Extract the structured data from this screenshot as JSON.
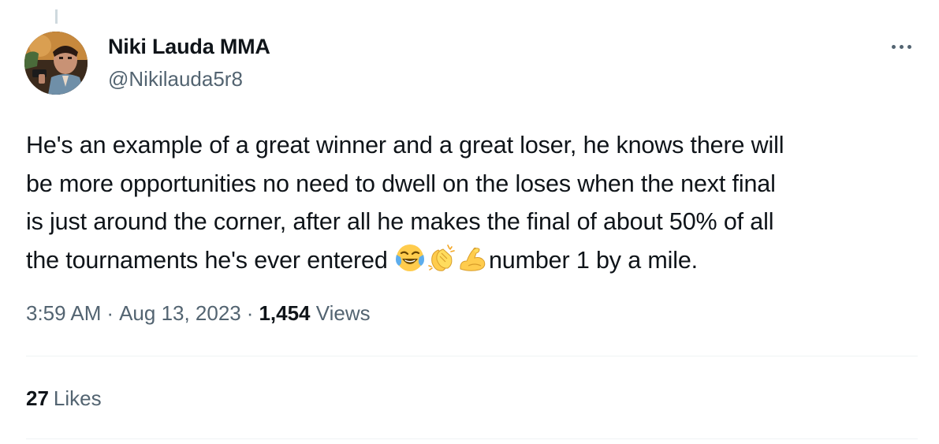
{
  "author": {
    "display_name": "Niki Lauda MMA",
    "handle": "@Nikilauda5r8",
    "avatar_icon": "profile-photo"
  },
  "tweet": {
    "line1": "He's an example of a great winner and a great loser, he knows there will",
    "line2": "be more opportunities no need to dwell on the loses when the next final",
    "line3": "is just around the corner, after all he makes the final of about 50% of all",
    "line4_before": "the tournaments he's ever entered ",
    "line4_after": "number 1 by a mile.",
    "emojis": [
      "face-with-tears-of-joy-emoji",
      "clapping-hands-emoji",
      "flexed-biceps-emoji"
    ]
  },
  "meta": {
    "time": "3:59 AM",
    "date": "Aug 13, 2023",
    "separator": "·",
    "views_count": "1,454",
    "views_label": "Views"
  },
  "engagement": {
    "likes_count": "27",
    "likes_label": "Likes"
  },
  "colors": {
    "text_primary": "#0f1419",
    "text_secondary": "#536471",
    "divider": "#eff3f4"
  }
}
